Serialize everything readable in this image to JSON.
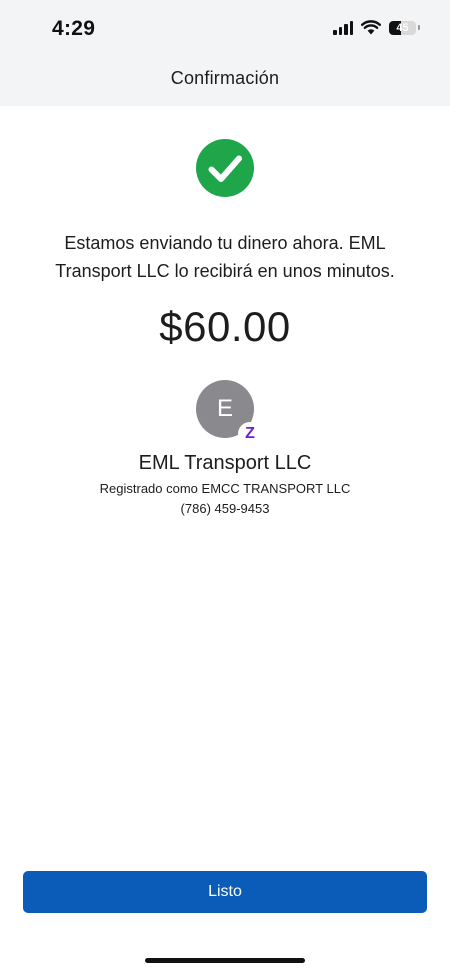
{
  "status_bar": {
    "time": "4:29",
    "battery_level": "45",
    "icons": [
      "cellular-signal-icon",
      "wifi-icon",
      "battery-icon"
    ]
  },
  "header": {
    "title": "Confirmación"
  },
  "confirmation": {
    "status_icon": "checkmark-circle-icon",
    "message": "Estamos enviando tu dinero ahora. EML Transport LLC lo recibirá en unos minutos.",
    "amount": "$60.00"
  },
  "recipient": {
    "avatar_initial": "E",
    "badge_icon": "zelle-icon",
    "badge_glyph": "Z",
    "name": "EML Transport LLC",
    "registered_as": "Registrado como EMCC TRANSPORT LLC",
    "phone": "(786) 459-9453"
  },
  "actions": {
    "done_label": "Listo"
  },
  "colors": {
    "success_green": "#1fa64a",
    "button_blue": "#0a5cb8",
    "zelle_purple": "#6d1ed4",
    "avatar_gray": "#8a8a8e",
    "header_bg": "#f3f4f6"
  }
}
